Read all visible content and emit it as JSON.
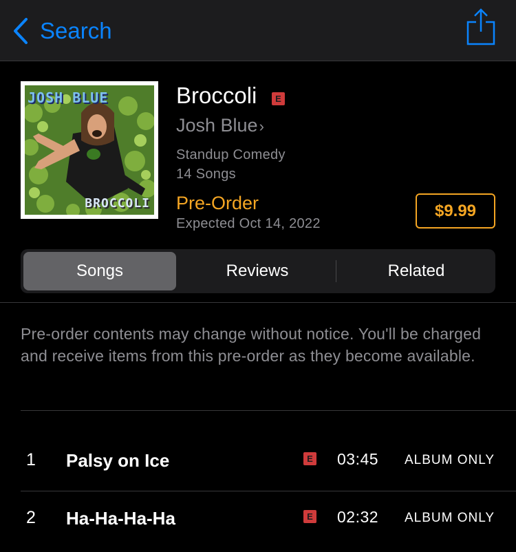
{
  "nav": {
    "back_label": "Search"
  },
  "album": {
    "title": "Broccoli",
    "explicit_badge": "E",
    "artist": "Josh Blue",
    "genre": "Standup Comedy",
    "song_count": "14 Songs",
    "preorder_label": "Pre-Order",
    "expected": "Expected Oct 14, 2022",
    "price": "$9.99",
    "cover_text_top": "JOSH BLUE",
    "cover_text_bottom": "BROCCOLI"
  },
  "tabs": [
    {
      "label": "Songs",
      "selected": true
    },
    {
      "label": "Reviews",
      "selected": false
    },
    {
      "label": "Related",
      "selected": false
    }
  ],
  "notice": "Pre-order contents may change without notice. You'll be charged and receive items from this pre-order as they become available.",
  "tracks": [
    {
      "num": "1",
      "title": "Palsy on Ice",
      "explicit": "E",
      "duration": "03:45",
      "availability": "ALBUM ONLY"
    },
    {
      "num": "2",
      "title": "Ha-Ha-Ha-Ha",
      "explicit": "E",
      "duration": "02:32",
      "availability": "ALBUM ONLY"
    }
  ],
  "colors": {
    "accent_blue": "#0a84ff",
    "accent_orange": "#f5a623",
    "explicit_red": "#cf3b3b",
    "background": "#000000",
    "nav_background": "#1c1c1e"
  },
  "icons": {
    "back": "chevron-left-icon",
    "share": "share-icon",
    "artist_link": "chevron-right-icon"
  }
}
